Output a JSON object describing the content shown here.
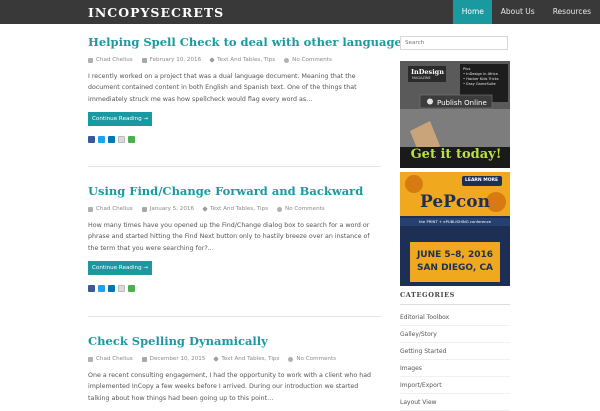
{
  "site": {
    "logo": "INCOPYSECRETS"
  },
  "nav": [
    {
      "label": "Home",
      "active": true
    },
    {
      "label": "About Us",
      "active": false
    },
    {
      "label": "Resources",
      "active": false
    }
  ],
  "posts": [
    {
      "title": "Helping Spell Check to deal with other languages",
      "author": "Chad Chelius",
      "date": "February 10, 2016",
      "categories": "Text And Tables, Tips",
      "comments": "No Comments",
      "excerpt": "I recently worked on a project that was a dual language document. Meaning that the document contained content in both English and Spanish text. One of the things that immediately struck me was how spellcheck would flag every word as…",
      "button": "Continue Reading →"
    },
    {
      "title": "Using Find/Change Forward and Backward",
      "author": "Chad Chelius",
      "date": "January 5, 2016",
      "categories": "Text And Tables, Tips",
      "comments": "No Comments",
      "excerpt": "How many times have you opened up the Find/Change dialog box to search for a word or phrase and started hitting the Find Next button only to hastily breeze over an instance of the term that you were searching for?…",
      "button": "Continue Reading →"
    },
    {
      "title": "Check Spelling Dynamically",
      "author": "Chad Chelius",
      "date": "December 10, 2015",
      "categories": "Text And Tables, Tips",
      "comments": "No Comments",
      "excerpt": "One a recent consulting engagement, I had the opportunity to work with a client who had implemented InCopy a few weeks before I arrived. During our introduction we started talking about how things had been going up to this point…"
    }
  ],
  "sidebar": {
    "search_placeholder": "Search",
    "ad1": {
      "logo": "InDesign",
      "logo_sub": "MAGAZINE",
      "bullets": [
        "Plus",
        "• InDesign in Africa",
        "• Hacker Kids Tricks",
        "• Easy GameSuite"
      ],
      "button": "Publish Online",
      "tagline": "Get it today!"
    },
    "ad2": {
      "learn": "LEARN MORE",
      "brand": "PePcon",
      "tag": "the PRINT + ePUBLISHING conference",
      "dates": "JUNE 5–8, 2016",
      "city": "SAN DIEGO, CA"
    },
    "categories_heading": "CATEGORIES",
    "categories": [
      "Editorial Toolbox",
      "Galley/Story",
      "Getting Started",
      "Images",
      "Import/Export",
      "Layout View"
    ]
  },
  "colors": {
    "accent": "#1a9aa0",
    "header": "#393939"
  }
}
